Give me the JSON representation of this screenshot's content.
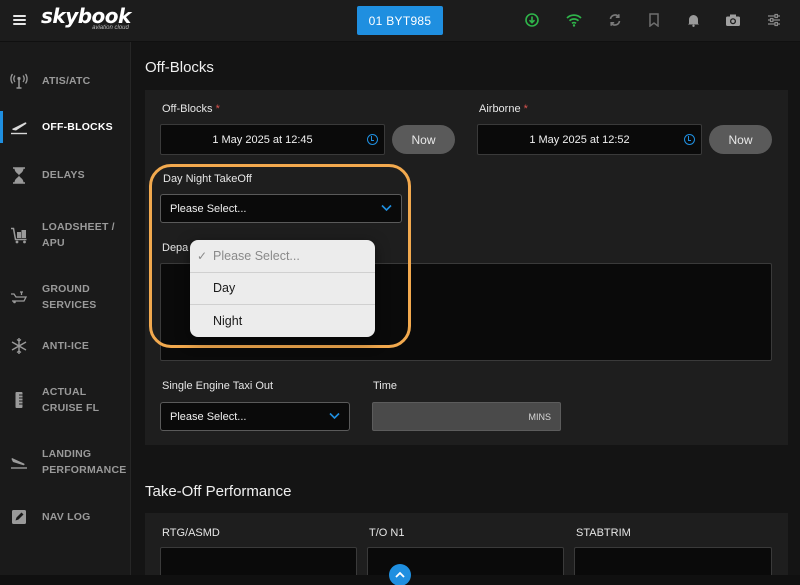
{
  "app": {
    "logo_text": "skybook",
    "logo_tagline": "aviation cloud"
  },
  "header": {
    "flight_button": "01 BYT985",
    "icons": [
      "download-icon",
      "wifi-icon",
      "sync-icon",
      "bookmark-icon",
      "bell-icon",
      "camera-icon",
      "sliders-icon"
    ]
  },
  "sidebar": {
    "items": [
      {
        "label": "ATIS/ATC",
        "icon": "antenna-icon"
      },
      {
        "label": "OFF-BLOCKS",
        "icon": "takeoff-icon",
        "active": true
      },
      {
        "label": "DELAYS",
        "icon": "hourglass-icon"
      },
      {
        "label": "LOADSHEET / APU",
        "icon": "luggage-cart-icon"
      },
      {
        "label": "GROUND SERVICES",
        "icon": "fuel-icon"
      },
      {
        "label": "ANTI-ICE",
        "icon": "snowflake-icon"
      },
      {
        "label": "ACTUAL CRUISE FL",
        "icon": "ruler-icon"
      },
      {
        "label": "LANDING PERFORMANCE",
        "icon": "landing-icon"
      },
      {
        "label": "NAV LOG",
        "icon": "pencil-icon"
      }
    ]
  },
  "offblocks": {
    "title": "Off-Blocks",
    "offblocks_label": "Off-Blocks",
    "offblocks_value": "1 May 2025 at 12:45",
    "airborne_label": "Airborne",
    "airborne_value": "1 May 2025 at 12:52",
    "required_mark": "*",
    "now_label": "Now",
    "day_night_label": "Day Night TakeOff",
    "day_night_value": "Please Select...",
    "departure_label_partial": "Depa",
    "single_engine_label": "Single Engine Taxi Out",
    "single_engine_value": "Please Select...",
    "time_label": "Time",
    "time_unit": "MINS"
  },
  "dropdown": {
    "options": [
      {
        "label": "Please Select...",
        "selected": true,
        "check": "✓"
      },
      {
        "label": "Day",
        "selected": false
      },
      {
        "label": "Night",
        "selected": false
      }
    ]
  },
  "takeoff_performance": {
    "title": "Take-Off Performance",
    "fields": [
      "RTG/ASMD",
      "T/O N1",
      "STABTRIM"
    ]
  },
  "colors": {
    "accent": "#1f8fe0",
    "highlight": "#f2a94e",
    "required": "#d9534f"
  }
}
